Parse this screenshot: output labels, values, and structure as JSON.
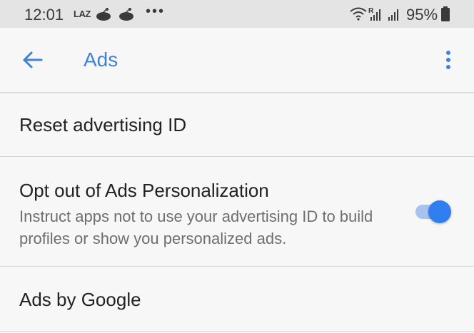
{
  "status_bar": {
    "time": "12:01",
    "carrier_label": "LAZ",
    "overflow_dots": "•••",
    "battery_percent": "95%",
    "roaming_indicator": "R"
  },
  "app_bar": {
    "title": "Ads",
    "back_icon": "arrow-back-icon",
    "menu_icon": "more-vert-icon"
  },
  "settings": {
    "reset_label": "Reset advertising ID",
    "opt_out": {
      "label": "Opt out of Ads Personalization",
      "summary": "Instruct apps not to use your advertising ID to build profiles or show you personalized ads.",
      "enabled": true
    },
    "ads_by_google_label": "Ads by Google"
  },
  "colors": {
    "accent": "#3f82d6",
    "toggle_thumb": "#2f7ff0",
    "toggle_track": "#a6c3f0",
    "status_bar_bg": "#e4e4e4",
    "background": "#f7f7f7"
  }
}
